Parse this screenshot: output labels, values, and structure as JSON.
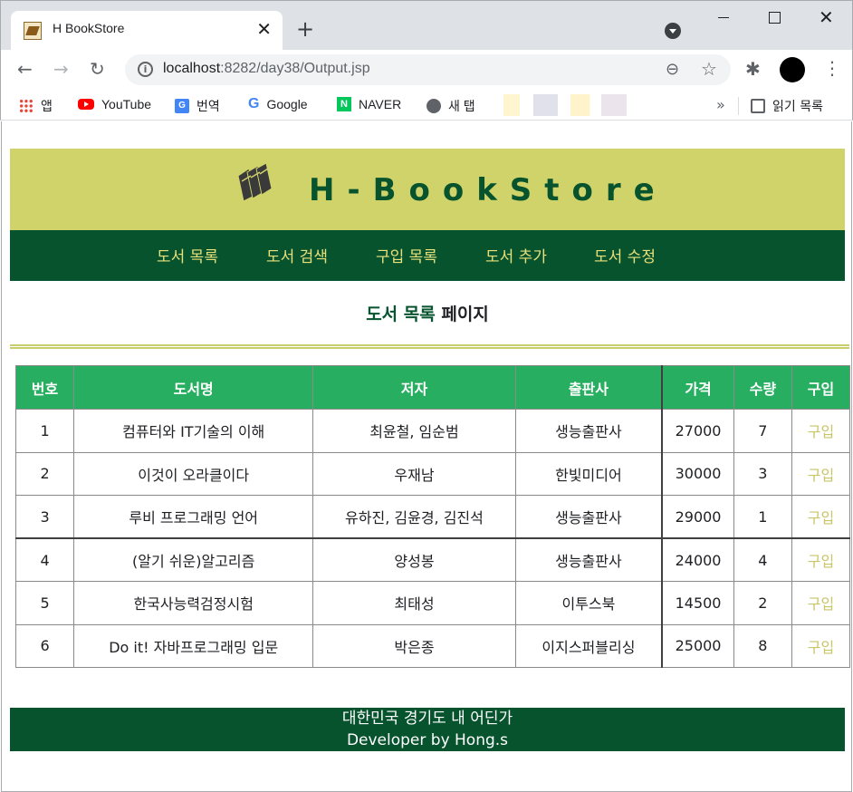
{
  "browser": {
    "tab_title": "H BookStore",
    "url_host": "localhost",
    "url_rest": ":8282/day38/Output.jsp"
  },
  "bookmarks": {
    "items": [
      "앱",
      "YouTube",
      "번역",
      "Google",
      "NAVER",
      "새 탭"
    ],
    "more": "»",
    "reading_list": "읽기 목록"
  },
  "site": {
    "title": "H-BookStore",
    "nav": [
      "도서 목록",
      "도서 검색",
      "구입 목록",
      "도서 추가",
      "도서 수정"
    ],
    "section_title_accent": "도서 목록",
    "section_title_rest": " 페이지"
  },
  "table": {
    "headers": [
      "번호",
      "도서명",
      "저자",
      "출판사",
      "가격",
      "수량",
      "구입"
    ],
    "rows": [
      {
        "no": "1",
        "title": "컴퓨터와 IT기술의 이해",
        "author": "최윤철, 임순범",
        "publisher": "생능출판사",
        "price": "27000",
        "qty": "7",
        "buy": "구입"
      },
      {
        "no": "2",
        "title": "이것이 오라클이다",
        "author": "우재남",
        "publisher": "한빛미디어",
        "price": "30000",
        "qty": "3",
        "buy": "구입"
      },
      {
        "no": "3",
        "title": "루비 프로그래밍 언어",
        "author": "유하진, 김윤경, 김진석",
        "publisher": "생능출판사",
        "price": "29000",
        "qty": "1",
        "buy": "구입"
      },
      {
        "no": "4",
        "title": "(알기 쉬운)알고리즘",
        "author": "양성봉",
        "publisher": "생능출판사",
        "price": "24000",
        "qty": "4",
        "buy": "구입"
      },
      {
        "no": "5",
        "title": "한국사능력검정시험",
        "author": "최태성",
        "publisher": "이투스북",
        "price": "14500",
        "qty": "2",
        "buy": "구입"
      },
      {
        "no": "6",
        "title": "Do it! 자바프로그래밍 입문",
        "author": "박은종",
        "publisher": "이지스퍼블리싱",
        "price": "25000",
        "qty": "8",
        "buy": "구입"
      }
    ]
  },
  "footer": {
    "line1": "대한민국 경기도 내 어딘가",
    "line2": "Developer by Hong.s"
  },
  "colors": {
    "header_band": "#d0d36a",
    "nav_band": "#06532e",
    "table_header": "#27ae60",
    "buy_link": "#c9c66a"
  }
}
